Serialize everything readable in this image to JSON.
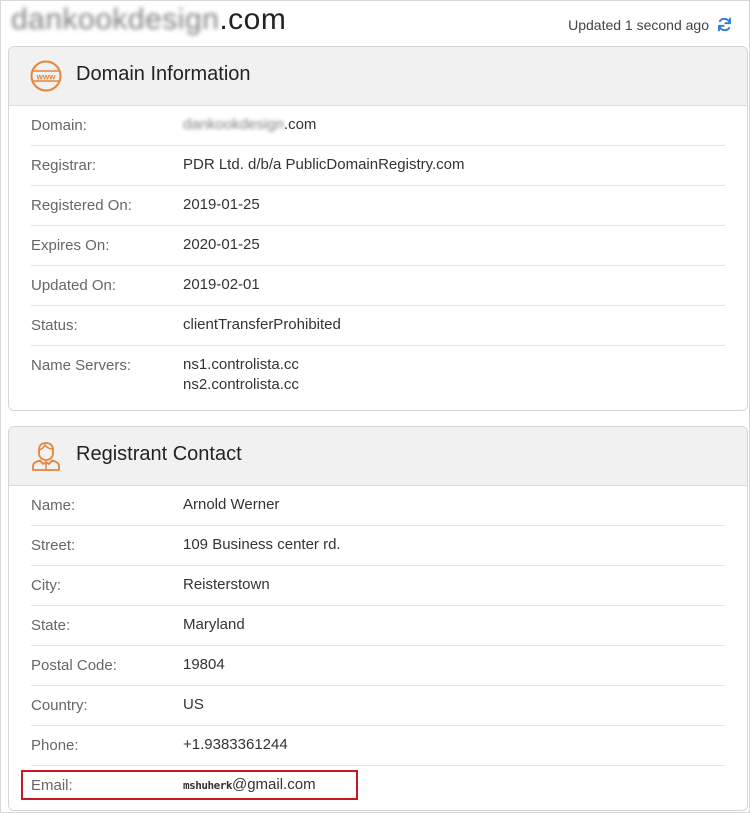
{
  "header": {
    "site_title_blurred": "dankookdesign",
    "site_title_tld": ".com",
    "updated_text": "Updated 1 second ago",
    "refresh_icon": "refresh-icon"
  },
  "domain_info": {
    "title": "Domain Information",
    "icon": "www-globe-icon",
    "rows": [
      {
        "label": "Domain:",
        "value_blurred": "dankookdesign",
        "value_suffix": ".com"
      },
      {
        "label": "Registrar:",
        "value": "PDR Ltd. d/b/a PublicDomainRegistry.com"
      },
      {
        "label": "Registered On:",
        "value": "2019-01-25"
      },
      {
        "label": "Expires On:",
        "value": "2020-01-25"
      },
      {
        "label": "Updated On:",
        "value": "2019-02-01"
      },
      {
        "label": "Status:",
        "value": "clientTransferProhibited"
      },
      {
        "label": "Name Servers:",
        "value_lines": [
          "ns1.controlista.cc",
          "ns2.controlista.cc"
        ]
      }
    ]
  },
  "registrant": {
    "title": "Registrant Contact",
    "icon": "person-icon",
    "rows": [
      {
        "label": "Name:",
        "value": "Arnold Werner"
      },
      {
        "label": "Street:",
        "value": "109 Business center rd."
      },
      {
        "label": "City:",
        "value": "Reisterstown"
      },
      {
        "label": "State:",
        "value": "Maryland"
      },
      {
        "label": "Postal Code:",
        "value": "19804"
      },
      {
        "label": "Country:",
        "value": "US"
      },
      {
        "label": "Phone:",
        "value": "+1.9383361244"
      },
      {
        "label": "Email:",
        "value_user": "mshuherk",
        "value_domain": "@gmail.com"
      }
    ]
  },
  "colors": {
    "accent_orange": "#e8833a",
    "refresh_blue": "#2a7fd4",
    "highlight_red": "#c8171e"
  }
}
